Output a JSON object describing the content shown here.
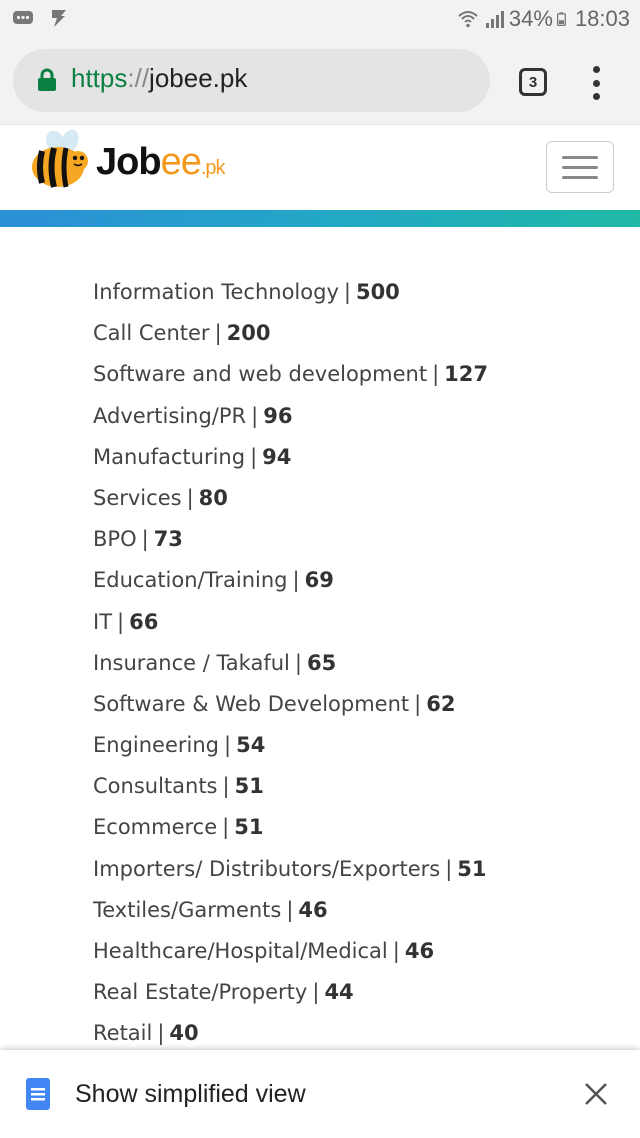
{
  "status_bar": {
    "battery": "34%",
    "time": "18:03",
    "icons": [
      "messages-icon",
      "app-notification-icon",
      "wifi-icon",
      "signal-icon",
      "battery-icon"
    ]
  },
  "browser": {
    "url_scheme": "https",
    "url_separator": "://",
    "url_host": "jobee.pk",
    "tab_count": "3",
    "lock_color": "#0b8043"
  },
  "site": {
    "logo_main": "Job",
    "logo_accent": "ee",
    "logo_tld": ".pk",
    "brand_color": "#f39a1e"
  },
  "categories": [
    {
      "name": "Information Technology",
      "count": "500"
    },
    {
      "name": "Call Center",
      "count": "200"
    },
    {
      "name": "Software and web development",
      "count": "127"
    },
    {
      "name": "Advertising/PR",
      "count": "96"
    },
    {
      "name": "Manufacturing",
      "count": "94"
    },
    {
      "name": "Services",
      "count": "80"
    },
    {
      "name": "BPO",
      "count": "73"
    },
    {
      "name": "Education/Training",
      "count": "69"
    },
    {
      "name": "IT",
      "count": "66"
    },
    {
      "name": "Insurance / Takaful",
      "count": "65"
    },
    {
      "name": "Software & Web Development",
      "count": "62"
    },
    {
      "name": "Engineering",
      "count": "54"
    },
    {
      "name": "Consultants",
      "count": "51"
    },
    {
      "name": "Ecommerce",
      "count": "51"
    },
    {
      "name": "Importers/ Distributors/Exporters",
      "count": "51"
    },
    {
      "name": "Textiles/Garments",
      "count": "46"
    },
    {
      "name": "Healthcare/Hospital/Medical",
      "count": "46"
    },
    {
      "name": "Real Estate/Property",
      "count": "44"
    },
    {
      "name": "Retail",
      "count": "40"
    }
  ],
  "separator": "|",
  "simplified_view": {
    "label": "Show simplified view"
  }
}
